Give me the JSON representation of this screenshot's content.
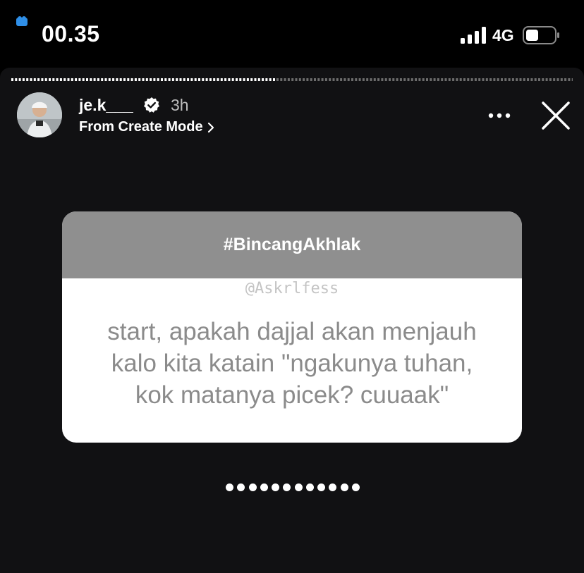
{
  "status_bar": {
    "time": "00.35",
    "network": "4G",
    "icons": [
      "signal-icon",
      "battery-icon"
    ]
  },
  "story": {
    "username": "je.k___",
    "time_ago": "3h",
    "source_label": "From Create Mode",
    "icons": [
      "verified-badge-icon",
      "chevron-right-icon",
      "more-options-icon",
      "close-icon"
    ]
  },
  "card": {
    "header": "#BincangAkhlak",
    "watermark": "@Askrlfess",
    "question_lines": [
      "start, apakah dajjal akan menjauh",
      "kalo kita katain \"ngakunya tuhan,",
      "kok matanya picek? cuuaak\""
    ]
  },
  "input_dots_count": 12,
  "colors": {
    "background": "#000000",
    "story_bg": "#111113",
    "card_header": "#8f8f8f",
    "question_text": "#8b8b8b"
  }
}
